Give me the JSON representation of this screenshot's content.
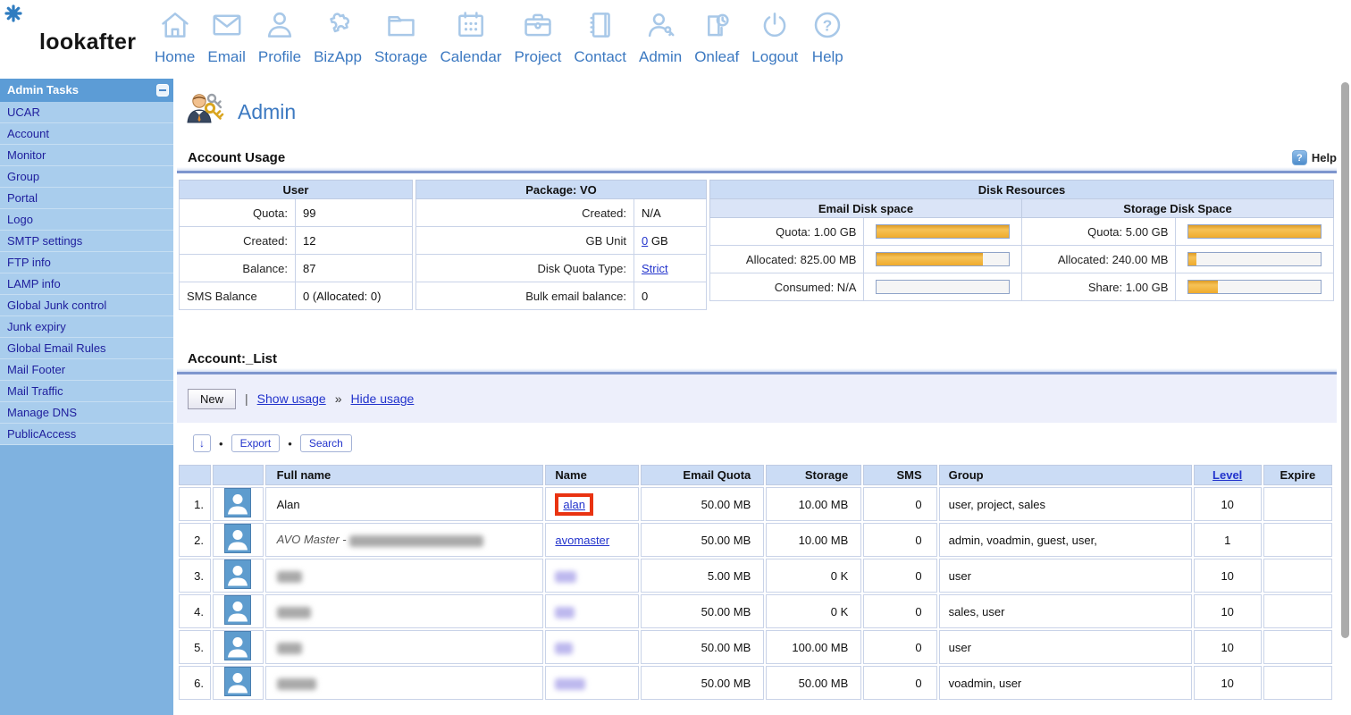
{
  "brand": {
    "logo": "lookafter"
  },
  "nav": {
    "items": [
      {
        "label": "Home"
      },
      {
        "label": "Email"
      },
      {
        "label": "Profile"
      },
      {
        "label": "BizApp"
      },
      {
        "label": "Storage"
      },
      {
        "label": "Calendar"
      },
      {
        "label": "Project"
      },
      {
        "label": "Contact"
      },
      {
        "label": "Admin"
      },
      {
        "label": "Onleaf"
      },
      {
        "label": "Logout"
      },
      {
        "label": "Help"
      }
    ]
  },
  "sidebar": {
    "title": "Admin Tasks",
    "items": [
      "UCAR",
      "Account",
      "Monitor",
      "Group",
      "Portal",
      "Logo",
      "SMTP settings",
      "FTP info",
      "LAMP info",
      "Global Junk control",
      "Junk expiry",
      "Global Email Rules",
      "Mail Footer",
      "Mail Traffic",
      "Manage DNS",
      "PublicAccess"
    ]
  },
  "page": {
    "title": "Admin",
    "help_label": "Help",
    "help_glyph": "?"
  },
  "usage": {
    "heading": "Account Usage",
    "user": {
      "header": "User",
      "rows": [
        [
          "Quota:",
          "99"
        ],
        [
          "Created:",
          "12"
        ],
        [
          "Balance:",
          "87"
        ],
        [
          "SMS Balance",
          "0 (Allocated: 0)"
        ]
      ]
    },
    "package": {
      "header": "Package: VO",
      "created_label": "Created:",
      "created_value": "N/A",
      "gb_unit_label": "GB Unit",
      "gb_unit_link": "0",
      "gb_unit_suffix": " GB",
      "quota_type_label": "Disk Quota Type:",
      "quota_type_link": "Strict",
      "bulk_label": "Bulk email balance:",
      "bulk_value": "0"
    },
    "disk": {
      "header": "Disk Resources",
      "email": {
        "title": "Email Disk space",
        "rows": [
          {
            "label": "Quota: 1.00 GB",
            "pct": 100
          },
          {
            "label": "Allocated: 825.00 MB",
            "pct": 80
          },
          {
            "label": "Consumed: N/A",
            "pct": 0
          }
        ]
      },
      "storage": {
        "title": "Storage Disk Space",
        "rows": [
          {
            "label": "Quota: 5.00 GB",
            "pct": 100
          },
          {
            "label": "Allocated: 240.00 MB",
            "pct": 6
          },
          {
            "label": "Share: 1.00 GB",
            "pct": 22
          }
        ]
      }
    },
    "bar_color": "#EFAB2D"
  },
  "account_list": {
    "heading": "Account:_List",
    "toolbar": {
      "new_label": "New",
      "pipe": "|",
      "show_usage": "Show usage",
      "chevron": "»",
      "hide_usage": "Hide usage",
      "sort_glyph": "↓",
      "bullet": "•",
      "export_label": "Export",
      "search_label": "Search"
    },
    "columns": [
      "Full name",
      "Name",
      "Email Quota",
      "Storage",
      "SMS",
      "Group",
      "Level",
      "Expire"
    ],
    "rows": [
      {
        "num": "1.",
        "full_name": "Alan",
        "name": "alan",
        "email_quota": "50.00 MB",
        "storage": "10.00 MB",
        "sms": "0",
        "group": "user, project, sales",
        "level": "10",
        "expire": ""
      },
      {
        "num": "2.",
        "full_name": "AVO Master -",
        "name": "avomaster",
        "email_quota": "50.00 MB",
        "storage": "10.00 MB",
        "sms": "0",
        "group": "admin, voadmin, guest, user,",
        "level": "1",
        "expire": ""
      },
      {
        "num": "3.",
        "full_name": "",
        "name": "",
        "email_quota": "5.00 MB",
        "storage": "0 K",
        "sms": "0",
        "group": "user",
        "level": "10",
        "expire": ""
      },
      {
        "num": "4.",
        "full_name": "",
        "name": "",
        "email_quota": "50.00 MB",
        "storage": "0 K",
        "sms": "0",
        "group": "sales, user",
        "level": "10",
        "expire": ""
      },
      {
        "num": "5.",
        "full_name": "",
        "name": "",
        "email_quota": "50.00 MB",
        "storage": "100.00 MB",
        "sms": "0",
        "group": "user",
        "level": "10",
        "expire": ""
      },
      {
        "num": "6.",
        "full_name": "",
        "name": "",
        "email_quota": "50.00 MB",
        "storage": "50.00 MB",
        "sms": "0",
        "group": "voadmin, user",
        "level": "10",
        "expire": ""
      }
    ],
    "highlight_color": "#E93311"
  },
  "colors": {
    "nav_accent": "#3C79C1",
    "link": "#2233CC",
    "sidebar_header": "#5C9CD6",
    "sidebar_item_bg": "#A9CDED",
    "table_header_bg": "#CBDCF5",
    "bar_orange": "#EFAB2D"
  }
}
